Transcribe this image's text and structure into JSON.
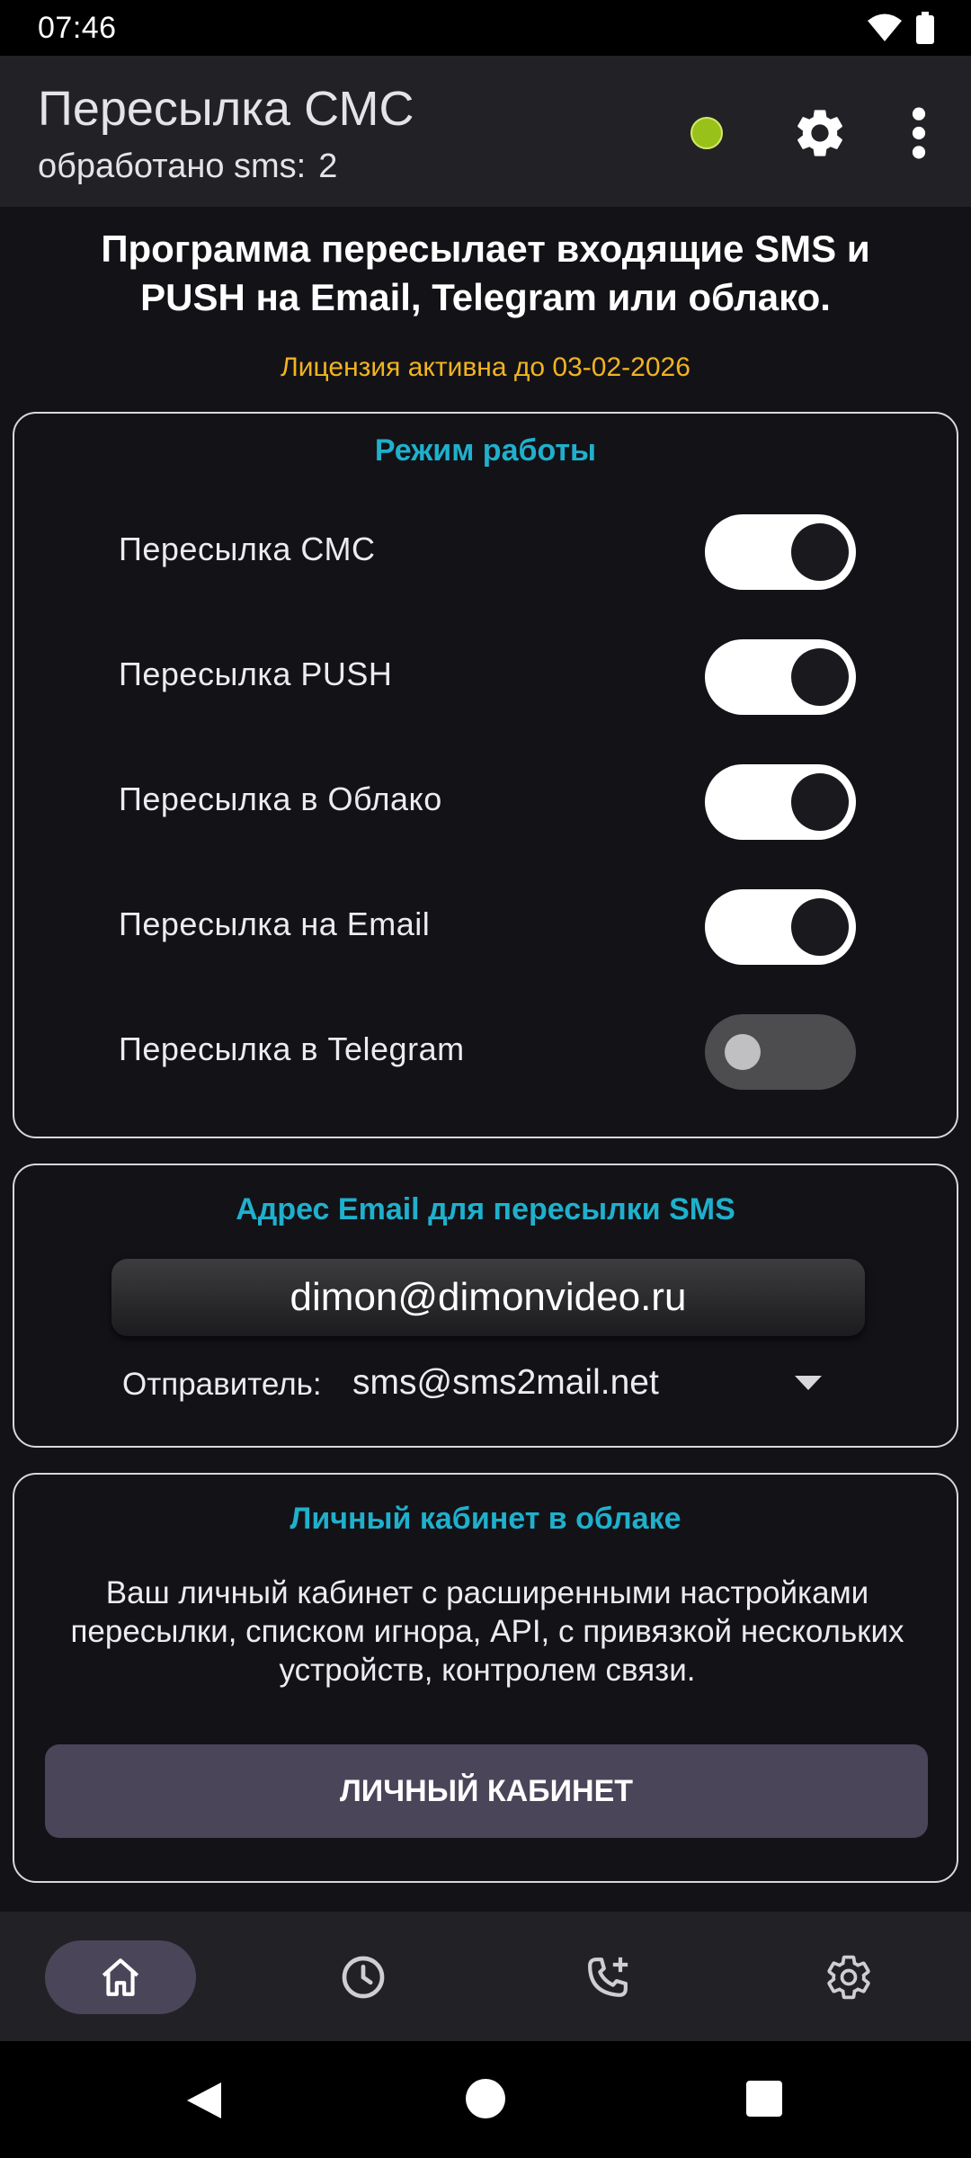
{
  "status_bar": {
    "time": "07:46",
    "icons": [
      "wifi-icon",
      "battery-icon"
    ]
  },
  "app_bar": {
    "title": "Пересылка СМС",
    "subtitle_label": "обработано sms:",
    "subtitle_count": "2",
    "status_dot_color": "#98c21a",
    "icons": [
      "gear-icon",
      "more-vert-icon"
    ]
  },
  "intro": {
    "text": "Программа пересылает входящие SMS и PUSH на Email, Telegram или облако.",
    "license": "Лицензия активна до 03-02-2026"
  },
  "mode_card": {
    "title": "Режим работы",
    "toggles": [
      {
        "label": "Пересылка СМС",
        "on": true
      },
      {
        "label": "Пересылка PUSH",
        "on": true
      },
      {
        "label": "Пересылка в Облако",
        "on": true
      },
      {
        "label": "Пересылка на Email",
        "on": true
      },
      {
        "label": "Пересылка в Telegram",
        "on": false
      }
    ]
  },
  "email_card": {
    "title": "Адрес Email для пересылки SMS",
    "email": "dimon@dimonvideo.ru",
    "sender_label": "Отправитель:",
    "sender_value": "sms@sms2mail.net"
  },
  "cabinet_card": {
    "title": "Личный кабинет в облаке",
    "description": "Ваш личный кабинет с расширенными настройками пересылки, списком игнора, API, с привязкой нескольких устройств, контролем связи.",
    "button_label": "ЛИЧНЫЙ КАБИНЕТ"
  },
  "bottom_nav": {
    "items": [
      {
        "icon": "home-icon",
        "active": true
      },
      {
        "icon": "history-icon",
        "active": false
      },
      {
        "icon": "phone-add-icon",
        "active": false
      },
      {
        "icon": "settings-icon",
        "active": false
      }
    ]
  },
  "colors": {
    "accent_title": "#1fb0cc",
    "license": "#f0b420",
    "button": "#4a4559",
    "background": "#131217"
  }
}
